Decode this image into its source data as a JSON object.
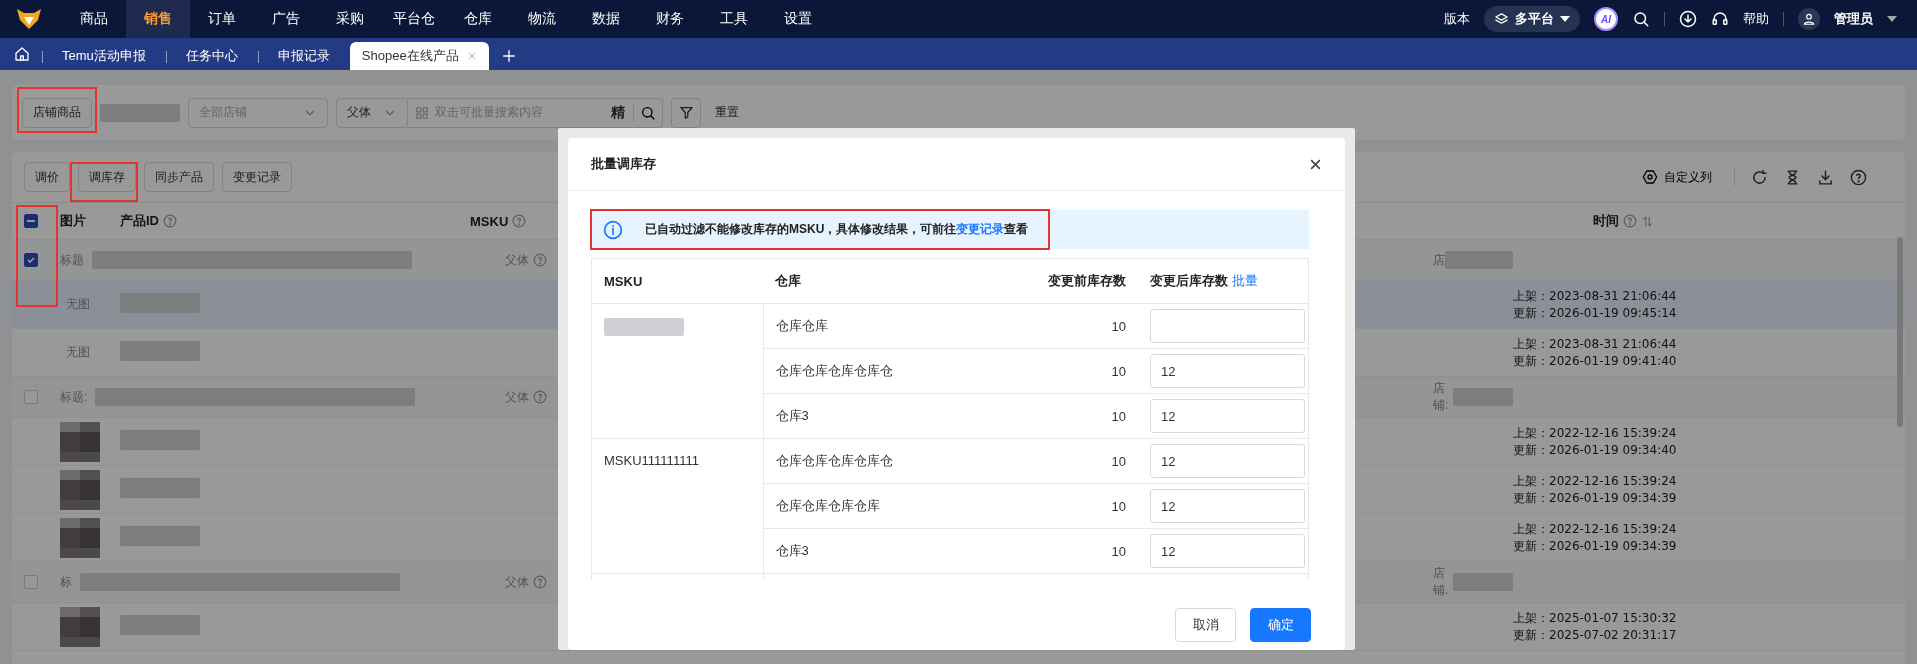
{
  "nav": {
    "menu": [
      {
        "label": "商品",
        "selected": false
      },
      {
        "label": "销售",
        "selected": true
      },
      {
        "label": "订单",
        "selected": false
      },
      {
        "label": "广告",
        "selected": false
      },
      {
        "label": "采购",
        "selected": false
      },
      {
        "label": "平台仓",
        "selected": false
      },
      {
        "label": "仓库",
        "selected": false
      },
      {
        "label": "物流",
        "selected": false
      },
      {
        "label": "数据",
        "selected": false
      },
      {
        "label": "财务",
        "selected": false
      },
      {
        "label": "工具",
        "selected": false
      },
      {
        "label": "设置",
        "selected": false
      }
    ],
    "version_label": "版本",
    "platform": "多平台",
    "ai_badge": "AI",
    "help": "帮助",
    "user": "管理员"
  },
  "tabs": [
    {
      "label": "Temu活动申报",
      "selected": false,
      "closable": false
    },
    {
      "label": "任务中心",
      "selected": false,
      "closable": false
    },
    {
      "label": "申报记录",
      "selected": false,
      "closable": false
    },
    {
      "label": "Shopee在线产品",
      "selected": true,
      "closable": true
    }
  ],
  "filter": {
    "shop_goods_button": {
      "label": "店铺商品",
      "highlighted": true
    },
    "shop_select": {
      "placeholder": "全部店铺"
    },
    "field_select": "父体",
    "search": {
      "placeholder": "双击可批量搜索内容"
    },
    "exact_toggle": "精",
    "reset": "重置"
  },
  "toolbar": {
    "buttons": [
      {
        "label": "调价",
        "highlighted": false
      },
      {
        "label": "调库存",
        "highlighted": true
      },
      {
        "label": "同步产品",
        "highlighted": false
      },
      {
        "label": "变更记录",
        "highlighted": false
      }
    ],
    "custom_columns": "自定义列"
  },
  "table": {
    "checkbox_column_highlighted": true,
    "header_checkbox": {
      "indeterminate": true
    },
    "columns": [
      {
        "label": "图片",
        "help": false,
        "sortable": false
      },
      {
        "label": "产品ID",
        "help": true,
        "sortable": false
      },
      {
        "label": "MSKU",
        "help": true,
        "sortable": false
      },
      {
        "label": "时间",
        "help": true,
        "sortable": true
      }
    ],
    "groups": [
      {
        "title_label": "标题",
        "checked": true,
        "parent_label": "父体",
        "shop_label": "店",
        "items": [
          {
            "image": {
              "kind": "no_image",
              "label": "无图"
            },
            "selected": true,
            "listed": "上架：2023-08-31 21:06:44",
            "updated": "更新：2026-01-19 09:45:14"
          },
          {
            "image": {
              "kind": "no_image",
              "label": "无图"
            },
            "selected": false,
            "listed": "上架：2023-08-31 21:06:44",
            "updated": "更新：2026-01-19 09:41:40"
          }
        ]
      },
      {
        "title_label": "标题:",
        "checked": false,
        "parent_label": "父体",
        "shop_label": "店铺:",
        "items": [
          {
            "selected": false,
            "listed": "上架：2022-12-16 15:39:24",
            "updated": "更新：2026-01-19 09:34:40"
          },
          {
            "selected": false,
            "listed": "上架：2022-12-16 15:39:24",
            "updated": "更新：2026-01-19 09:34:39"
          },
          {
            "selected": false,
            "listed": "上架：2022-12-16 15:39:24",
            "updated": "更新：2026-01-19 09:34:39"
          }
        ]
      },
      {
        "title_label": "标",
        "checked": false,
        "parent_label": "父体",
        "shop_label": "店铺.",
        "items": [
          {
            "selected": false,
            "listed": "上架：2025-01-07 15:30:32",
            "updated": "更新：2025-07-02 20:31:17"
          }
        ]
      }
    ]
  },
  "modal": {
    "title": "批量调库存",
    "alert": {
      "text_before": "已自动过滤不能修改库存的MSKU，具体修改结果，可前往",
      "link": "变更记录",
      "text_after": "查看",
      "highlighted": true
    },
    "columns": [
      "MSKU",
      "仓库",
      "变更前库存数",
      "变更后库存数"
    ],
    "batch_link": "批量",
    "groups": [
      {
        "rows": [
          {
            "warehouse": "仓库仓库",
            "before": "10"
          },
          {
            "warehouse": "仓库仓库仓库仓库仓",
            "before": "10",
            "after": "12"
          },
          {
            "warehouse": "仓库3",
            "before": "10",
            "after": "12"
          }
        ]
      },
      {
        "msku": "MSKU111111111",
        "rows": [
          {
            "warehouse": "仓库仓库仓库仓库仓",
            "before": "10",
            "after": "12"
          },
          {
            "warehouse": "仓库仓库仓库仓库",
            "before": "10",
            "after": "12"
          },
          {
            "warehouse": "仓库3",
            "before": "10",
            "after": "12"
          }
        ]
      }
    ],
    "cancel": "取消",
    "confirm": "确定"
  }
}
